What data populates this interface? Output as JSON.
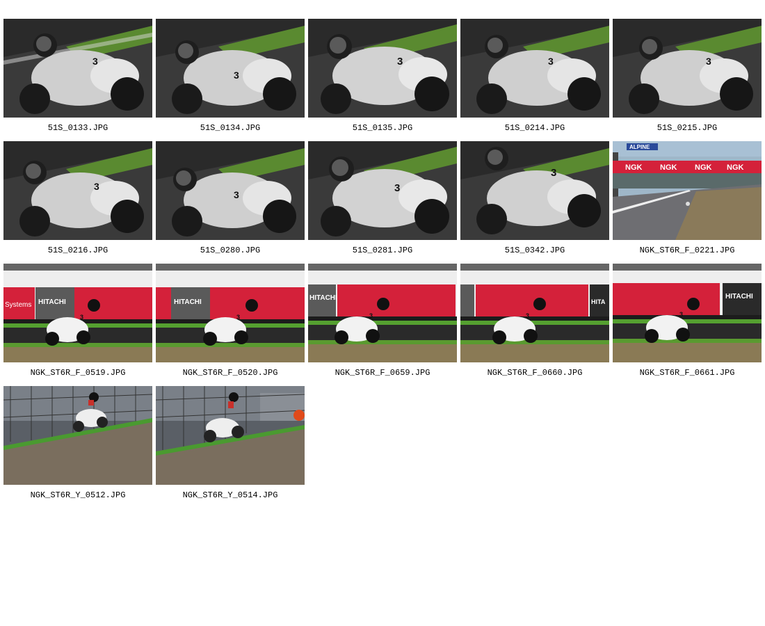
{
  "gallery": {
    "items": [
      {
        "filename": "51S_0133.JPG",
        "scene": "closeup"
      },
      {
        "filename": "51S_0134.JPG",
        "scene": "closeup"
      },
      {
        "filename": "51S_0135.JPG",
        "scene": "closeup"
      },
      {
        "filename": "51S_0214.JPG",
        "scene": "closeup"
      },
      {
        "filename": "51S_0215.JPG",
        "scene": "closeup"
      },
      {
        "filename": "51S_0216.JPG",
        "scene": "closeup"
      },
      {
        "filename": "51S_0280.JPG",
        "scene": "closeup"
      },
      {
        "filename": "51S_0281.JPG",
        "scene": "closeup"
      },
      {
        "filename": "51S_0342.JPG",
        "scene": "closeup"
      },
      {
        "filename": "NGK_ST6R_F_0221.JPG",
        "scene": "straight"
      },
      {
        "filename": "NGK_ST6R_F_0519.JPG",
        "scene": "banner"
      },
      {
        "filename": "NGK_ST6R_F_0520.JPG",
        "scene": "banner"
      },
      {
        "filename": "NGK_ST6R_F_0659.JPG",
        "scene": "banner"
      },
      {
        "filename": "NGK_ST6R_F_0660.JPG",
        "scene": "banner"
      },
      {
        "filename": "NGK_ST6R_F_0661.JPG",
        "scene": "banner"
      },
      {
        "filename": "NGK_ST6R_Y_0512.JPG",
        "scene": "gravel"
      },
      {
        "filename": "NGK_ST6R_Y_0514.JPG",
        "scene": "gravel"
      }
    ]
  }
}
